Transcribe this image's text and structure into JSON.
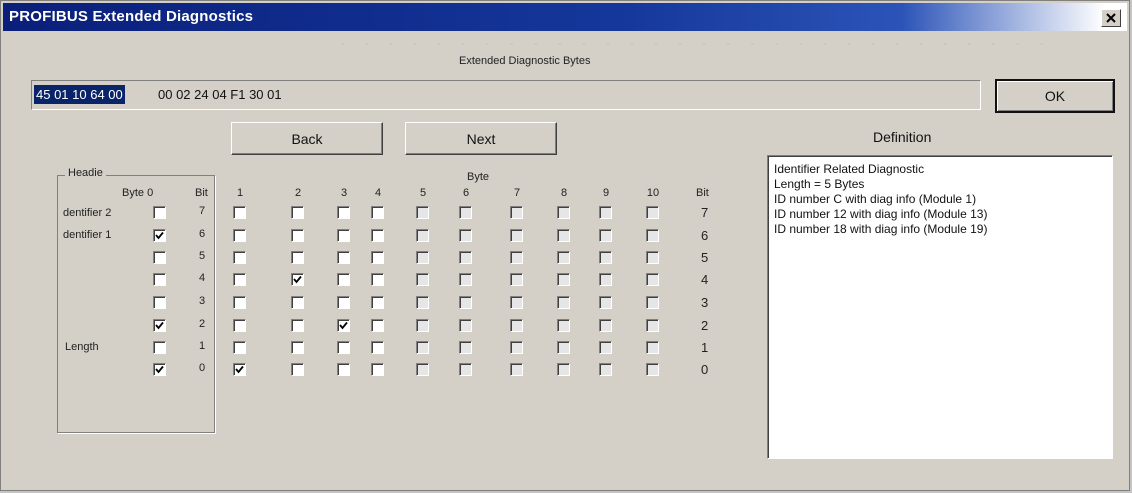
{
  "window": {
    "title": "PROFIBUS Extended Diagnostics",
    "close_glyph": "×"
  },
  "hex": {
    "label": "Extended Diagnostic Bytes",
    "selected": "45 01 10 64 00",
    "rest": "00 02 24 04 F1 30 01"
  },
  "buttons": {
    "ok": "OK",
    "back": "Back",
    "next": "Next"
  },
  "grid": {
    "group_title": "Headie",
    "byte0_header": "Byte 0",
    "bit_header": "Bit",
    "byte_group_label": "Byte",
    "right_bit_header": "Bit",
    "byte_columns": [
      "1",
      "2",
      "3",
      "4",
      "5",
      "6",
      "7",
      "8",
      "9",
      "10"
    ],
    "bits": [
      "7",
      "6",
      "5",
      "4",
      "3",
      "2",
      "1",
      "0"
    ],
    "row_labels": {
      "r0": "dentifier 2",
      "r1": "dentifier 1",
      "r5": "Length"
    },
    "byte0_checked": [
      false,
      true,
      false,
      false,
      false,
      true,
      false,
      true
    ],
    "cells_checked": [
      [
        false,
        false,
        false,
        false,
        false,
        false,
        false,
        false,
        false,
        false
      ],
      [
        false,
        false,
        false,
        false,
        false,
        false,
        false,
        false,
        false,
        false
      ],
      [
        false,
        false,
        false,
        false,
        false,
        false,
        false,
        false,
        false,
        false
      ],
      [
        false,
        true,
        false,
        false,
        false,
        false,
        false,
        false,
        false,
        false
      ],
      [
        false,
        false,
        false,
        false,
        false,
        false,
        false,
        false,
        false,
        false
      ],
      [
        false,
        false,
        true,
        false,
        false,
        false,
        false,
        false,
        false,
        false
      ],
      [
        false,
        false,
        false,
        false,
        false,
        false,
        false,
        false,
        false,
        false
      ],
      [
        true,
        false,
        false,
        false,
        false,
        false,
        false,
        false,
        false,
        false
      ]
    ],
    "dim_columns": [
      4,
      5,
      6,
      7,
      8,
      9
    ]
  },
  "definition": {
    "label": "Definition",
    "lines": [
      "Identifier Related Diagnostic",
      "Length = 5 Bytes",
      "ID number C with diag info (Module 1)",
      "ID number 12 with diag info (Module 13)",
      "ID number 18 with diag info (Module 19)"
    ]
  },
  "colors": {
    "title_bar": "#0a1f7a",
    "selection": "#0a246a",
    "dialog_bg": "#d4d0c8"
  }
}
